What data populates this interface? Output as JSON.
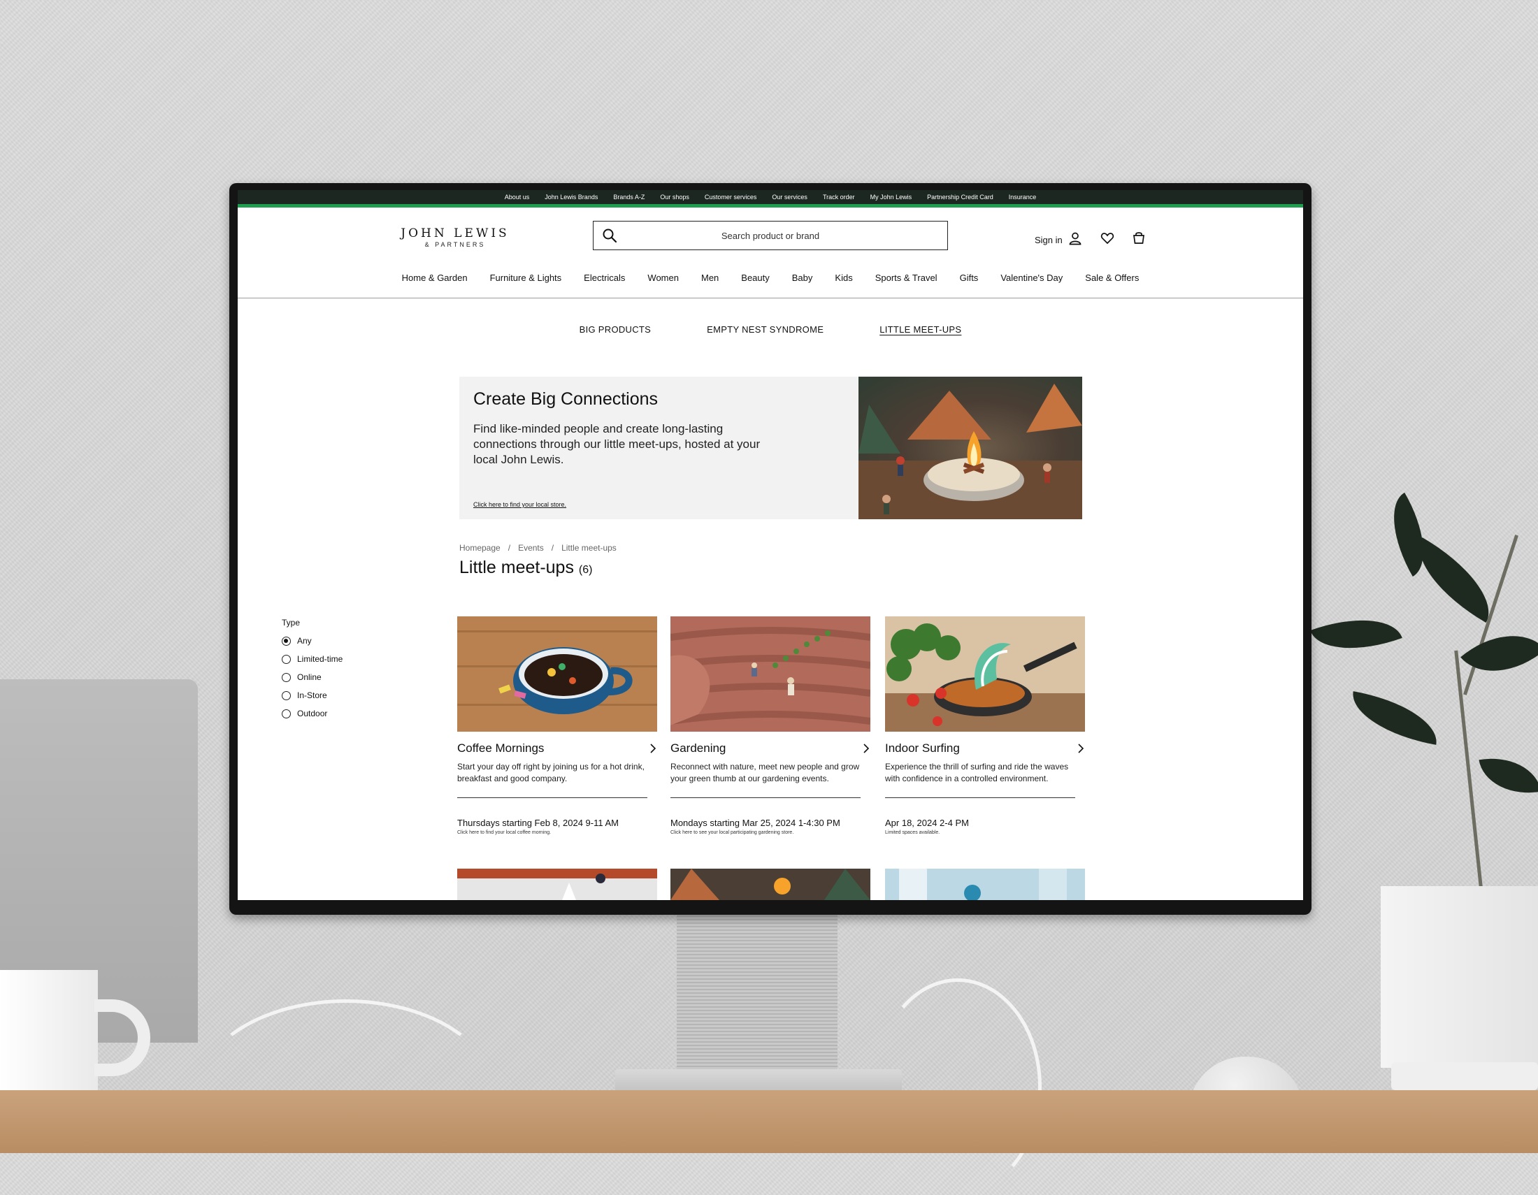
{
  "utility_nav": [
    "About us",
    "John Lewis Brands",
    "Brands A-Z",
    "Our shops",
    "Customer services",
    "Our services",
    "Track order",
    "My John Lewis",
    "Partnership Credit Card",
    "Insurance"
  ],
  "logo": {
    "main": "JOHN LEWIS",
    "sub": "& PARTNERS"
  },
  "search": {
    "placeholder": "Search product or brand"
  },
  "account": {
    "sign_in": "Sign in"
  },
  "main_nav": [
    "Home & Garden",
    "Furniture & Lights",
    "Electricals",
    "Women",
    "Men",
    "Beauty",
    "Baby",
    "Kids",
    "Sports & Travel",
    "Gifts",
    "Valentine's Day",
    "Sale & Offers"
  ],
  "sub_nav": [
    {
      "label": "BIG PRODUCTS",
      "active": false
    },
    {
      "label": "EMPTY NEST SYNDROME",
      "active": false
    },
    {
      "label": "LITTLE MEET-UPS",
      "active": true
    }
  ],
  "hero": {
    "title": "Create Big Connections",
    "text": "Find like-minded people and create long-lasting connections through our little meet-ups, hosted at your local John Lewis.",
    "link": "Click here to find your local store."
  },
  "breadcrumb": [
    "Homepage",
    "Events",
    "Little meet-ups"
  ],
  "page": {
    "title": "Little meet-ups",
    "count": "(6)"
  },
  "filter": {
    "title": "Type",
    "options": [
      {
        "label": "Any",
        "checked": true
      },
      {
        "label": "Limited-time",
        "checked": false
      },
      {
        "label": "Online",
        "checked": false
      },
      {
        "label": "In-Store",
        "checked": false
      },
      {
        "label": "Outdoor",
        "checked": false
      }
    ]
  },
  "cards": [
    {
      "title": "Coffee Mornings",
      "desc": "Start your day off right by joining us for a hot drink, breakfast and good company.",
      "date": "Thursdays starting Feb 8, 2024 9-11 AM",
      "note": "Click here to find your local coffee morning."
    },
    {
      "title": "Gardening",
      "desc": "Reconnect with nature, meet new people and grow your green thumb at our gardening events.",
      "date": "Mondays starting Mar 25, 2024 1-4:30 PM",
      "note": "Click here to see your local participating gardening store."
    },
    {
      "title": "Indoor Surfing",
      "desc": "Experience the thrill of surfing and ride the waves with confidence in a controlled environment.",
      "date": "Apr 18, 2024 2-4 PM",
      "note": "Limited spaces available."
    }
  ],
  "colors": {
    "utility_bar": "#1c2722",
    "accent_green": "#1f9e4f",
    "hero_bg": "#f2f2f2"
  }
}
